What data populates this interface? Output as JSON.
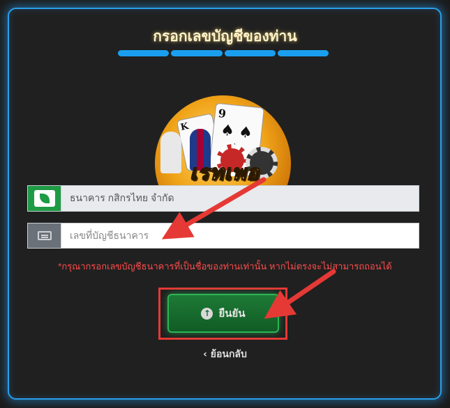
{
  "header": {
    "title": "กรอกเลขบัญชีของท่าน",
    "progress_steps": 4,
    "progress_completed": 4
  },
  "logo": {
    "brand_text": "เรทเพอ",
    "card1_rank": "K",
    "card2_rank": "9"
  },
  "form": {
    "bank_field": {
      "value": "ธนาคาร กสิกรไทย จำกัด",
      "icon": "bank-leaf-icon"
    },
    "account_field": {
      "placeholder": "เลขที่บัญชีธนาคาร",
      "value": "",
      "icon": "card-icon"
    },
    "warning": "*กรุณากรอกเลขบัญชีธนาคารที่เป็นชื่อของท่านเท่านั้น หากไม่ตรงจะไม่สามารถถอนได้"
  },
  "actions": {
    "confirm_label": "ยืนยัน",
    "back_label": "ย้อนกลับ"
  },
  "colors": {
    "accent": "#2a9fe8",
    "confirm": "#1e7a36",
    "warning": "#ff4b4b",
    "annotation": "#e53935"
  }
}
